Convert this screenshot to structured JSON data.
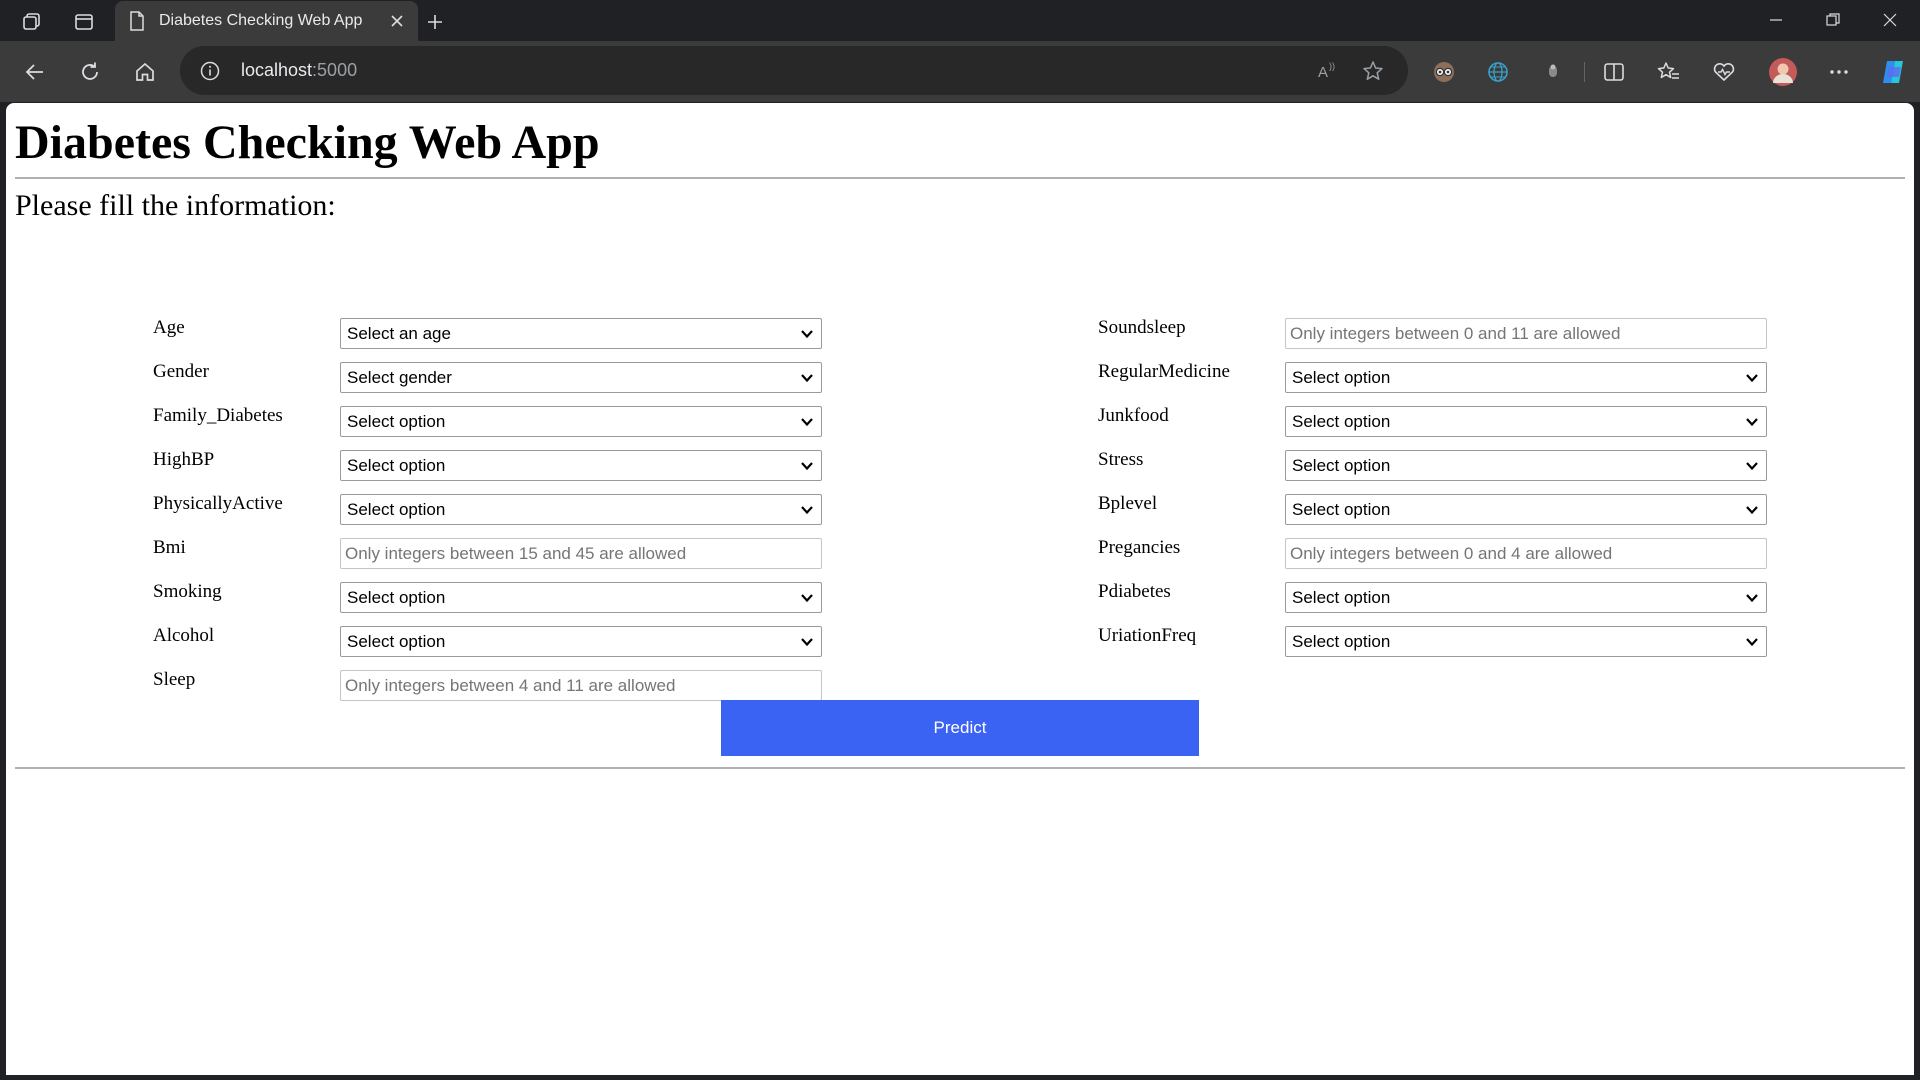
{
  "browser": {
    "tab_title": "Diabetes Checking Web App",
    "url_host": "localhost",
    "url_port": ":5000"
  },
  "page": {
    "title": "Diabetes Checking Web App",
    "subtitle": "Please fill the information:",
    "left_fields": [
      {
        "label": "Age",
        "type": "select",
        "value": "Select an age"
      },
      {
        "label": "Gender",
        "type": "select",
        "value": "Select gender"
      },
      {
        "label": "Family_Diabetes",
        "type": "select",
        "value": "Select option"
      },
      {
        "label": "HighBP",
        "type": "select",
        "value": "Select option"
      },
      {
        "label": "PhysicallyActive",
        "type": "select",
        "value": "Select option"
      },
      {
        "label": "Bmi",
        "type": "input",
        "placeholder": "Only integers between 15 and 45 are allowed"
      },
      {
        "label": "Smoking",
        "type": "select",
        "value": "Select option"
      },
      {
        "label": "Alcohol",
        "type": "select",
        "value": "Select option"
      },
      {
        "label": "Sleep",
        "type": "input",
        "placeholder": "Only integers between 4 and 11 are allowed"
      }
    ],
    "right_fields": [
      {
        "label": "Soundsleep",
        "type": "input",
        "placeholder": "Only integers between 0 and 11 are allowed"
      },
      {
        "label": "RegularMedicine",
        "type": "select",
        "value": "Select option"
      },
      {
        "label": "Junkfood",
        "type": "select",
        "value": "Select option"
      },
      {
        "label": "Stress",
        "type": "select",
        "value": "Select option"
      },
      {
        "label": "Bplevel",
        "type": "select",
        "value": "Select option"
      },
      {
        "label": "Pregancies",
        "type": "input",
        "placeholder": "Only integers between 0 and 4 are allowed"
      },
      {
        "label": "Pdiabetes",
        "type": "select",
        "value": "Select option"
      },
      {
        "label": "UriationFreq",
        "type": "select",
        "value": "Select option"
      }
    ],
    "predict_label": "Predict"
  },
  "colors": {
    "predict_button": "#3b63f3",
    "chrome_dark": "#202124",
    "chrome_toolbar": "#3b3b3b"
  },
  "icons": {
    "titlebar": [
      "workspaces-icon",
      "tab-actions-icon"
    ],
    "toolbar_right": [
      "read-aloud-icon",
      "favorite-star-icon",
      "extension-glasses-icon",
      "extension-globe-icon",
      "extension-pin-icon",
      "split-screen-icon",
      "favorites-icon",
      "browser-essentials-icon",
      "profile-avatar-icon",
      "more-options-icon",
      "copilot-icon"
    ]
  }
}
